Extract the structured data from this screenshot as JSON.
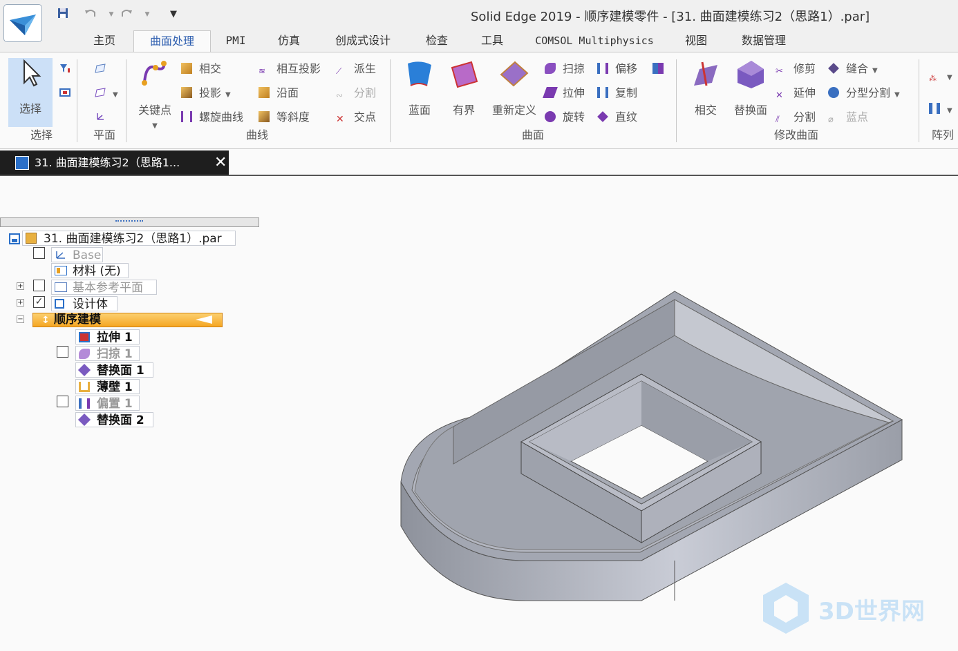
{
  "window": {
    "title": "Solid Edge 2019 - 顺序建模零件 - [31. 曲面建模练习2（思路1）.par]"
  },
  "quick_access": [
    "save-icon",
    "undo-icon",
    "redo-icon",
    "customize-icon"
  ],
  "tabs": [
    {
      "label": "主页"
    },
    {
      "label": "曲面处理",
      "active": true
    },
    {
      "label": "PMI"
    },
    {
      "label": "仿真"
    },
    {
      "label": "创成式设计"
    },
    {
      "label": "检查"
    },
    {
      "label": "工具"
    },
    {
      "label": "COMSOL Multiphysics"
    },
    {
      "label": "视图"
    },
    {
      "label": "数据管理"
    }
  ],
  "ribbon": {
    "select": {
      "button": "选择",
      "group": "选择"
    },
    "plane": {
      "group": "平面"
    },
    "curve": {
      "keypoint": "关键点",
      "items": [
        "相交",
        "投影",
        "螺旋曲线",
        "相互投影",
        "沿面",
        "等斜度",
        "派生",
        "分割",
        "交点"
      ],
      "group": "曲线"
    },
    "surface": {
      "big": [
        "蓝面",
        "有界",
        "重新定义"
      ],
      "items": [
        "扫掠",
        "拉伸",
        "旋转",
        "偏移",
        "复制",
        "直纹"
      ],
      "group": "曲面"
    },
    "modify": {
      "big": [
        "相交",
        "替换面"
      ],
      "items": [
        "修剪",
        "延伸",
        "分割",
        "缝合",
        "分型分割",
        "蓝点"
      ],
      "group": "修改曲面"
    },
    "array": {
      "group": "阵列"
    }
  },
  "document_tab": {
    "label": "31. 曲面建模练习2（思路1..."
  },
  "tree": {
    "root": "31. 曲面建模练习2（思路1）.par",
    "base": "Base",
    "material": "材料 (无)",
    "ref_planes": "基本参考平面",
    "design_body": "设计体",
    "ordered": "顺序建模",
    "features": [
      "拉伸 1",
      "扫掠 1",
      "替换面 1",
      "薄壁 1",
      "偏置 1",
      "替换面 2"
    ]
  },
  "watermark": {
    "text": "3D世界网"
  },
  "colors": {
    "accent": "#3060b0",
    "ordered_highlight": "#f5a623",
    "model_face": "#a3a7b2"
  }
}
